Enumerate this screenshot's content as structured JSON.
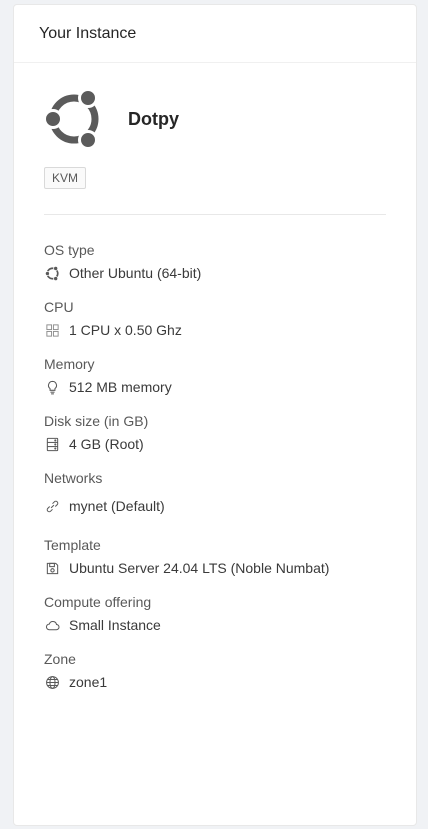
{
  "card": {
    "title": "Your Instance"
  },
  "instance": {
    "name": "Dotpy",
    "hypervisor_tag": "KVM"
  },
  "fields": [
    {
      "label": "OS type",
      "value": "Other Ubuntu (64-bit)",
      "icon": "ubuntu-icon"
    },
    {
      "label": "CPU",
      "value": "1 CPU x 0.50 Ghz",
      "icon": "cpu-grid-icon"
    },
    {
      "label": "Memory",
      "value": "512 MB memory",
      "icon": "bulb-icon"
    },
    {
      "label": "Disk size (in GB)",
      "value": "4 GB (Root)",
      "icon": "hdd-icon"
    },
    {
      "label": "Networks",
      "value": "mynet (Default)",
      "icon": "link-icon"
    },
    {
      "label": "Template",
      "value": "Ubuntu Server 24.04 LTS (Noble Numbat)",
      "icon": "save-icon"
    },
    {
      "label": "Compute offering",
      "value": "Small Instance",
      "icon": "cloud-icon"
    },
    {
      "label": "Zone",
      "value": "zone1",
      "icon": "globe-icon"
    }
  ],
  "colors": {
    "logo": "#5b5b5b",
    "text": "#262626",
    "muted": "#595959"
  }
}
